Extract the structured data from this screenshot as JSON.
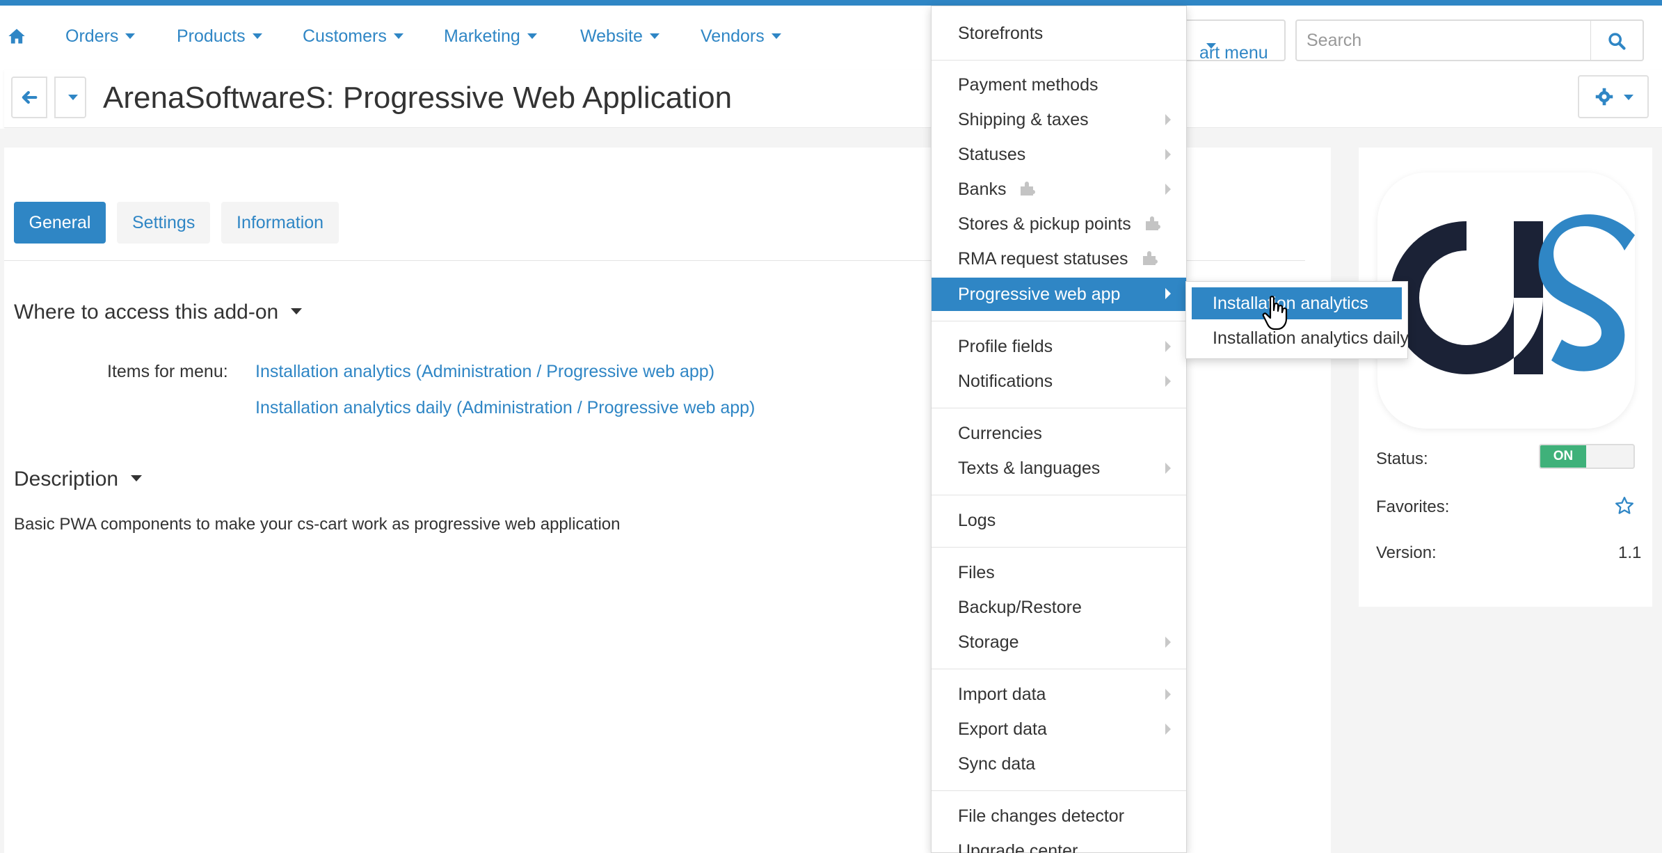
{
  "nav": {
    "items": [
      {
        "label": "Orders"
      },
      {
        "label": "Products"
      },
      {
        "label": "Customers"
      },
      {
        "label": "Marketing"
      },
      {
        "label": "Website"
      },
      {
        "label": "Vendors"
      }
    ],
    "quick_menu_label": "art menu",
    "search_placeholder": "Search"
  },
  "header": {
    "title": "ArenaSoftwareS: Progressive Web Application"
  },
  "tabs": [
    {
      "label": "General"
    },
    {
      "label": "Settings"
    },
    {
      "label": "Information"
    }
  ],
  "access": {
    "heading": "Where to access this add-on",
    "items_label": "Items for menu:",
    "links": [
      "Installation analytics (Administration / Progressive web app)",
      "Installation analytics daily (Administration / Progressive web app)"
    ]
  },
  "description": {
    "heading": "Description",
    "text": "Basic PWA components to make your cs-cart work as progressive web application"
  },
  "side": {
    "status_label": "Status:",
    "status_value": "ON",
    "favorites_label": "Favorites:",
    "version_label": "Version:",
    "version_value": "1.1"
  },
  "dropdown": {
    "items": [
      {
        "label": "Storefronts"
      },
      {
        "label": "Payment methods"
      },
      {
        "label": "Shipping & taxes"
      },
      {
        "label": "Statuses"
      },
      {
        "label": "Banks"
      },
      {
        "label": "Stores & pickup points"
      },
      {
        "label": "RMA request statuses"
      },
      {
        "label": "Progressive web app"
      },
      {
        "label": "Profile fields"
      },
      {
        "label": "Notifications"
      },
      {
        "label": "Currencies"
      },
      {
        "label": "Texts & languages"
      },
      {
        "label": "Logs"
      },
      {
        "label": "Files"
      },
      {
        "label": "Backup/Restore"
      },
      {
        "label": "Storage"
      },
      {
        "label": "Import data"
      },
      {
        "label": "Export data"
      },
      {
        "label": "Sync data"
      },
      {
        "label": "File changes detector"
      },
      {
        "label": "Upgrade center"
      }
    ]
  },
  "submenu": {
    "items": [
      {
        "label": "Installation analytics"
      },
      {
        "label": "Installation analytics daily"
      }
    ]
  },
  "colors": {
    "accent": "#2f86c5",
    "status_on": "#3fb17a",
    "logo_dark": "#1b2236",
    "logo_blue": "#2f86c5"
  }
}
